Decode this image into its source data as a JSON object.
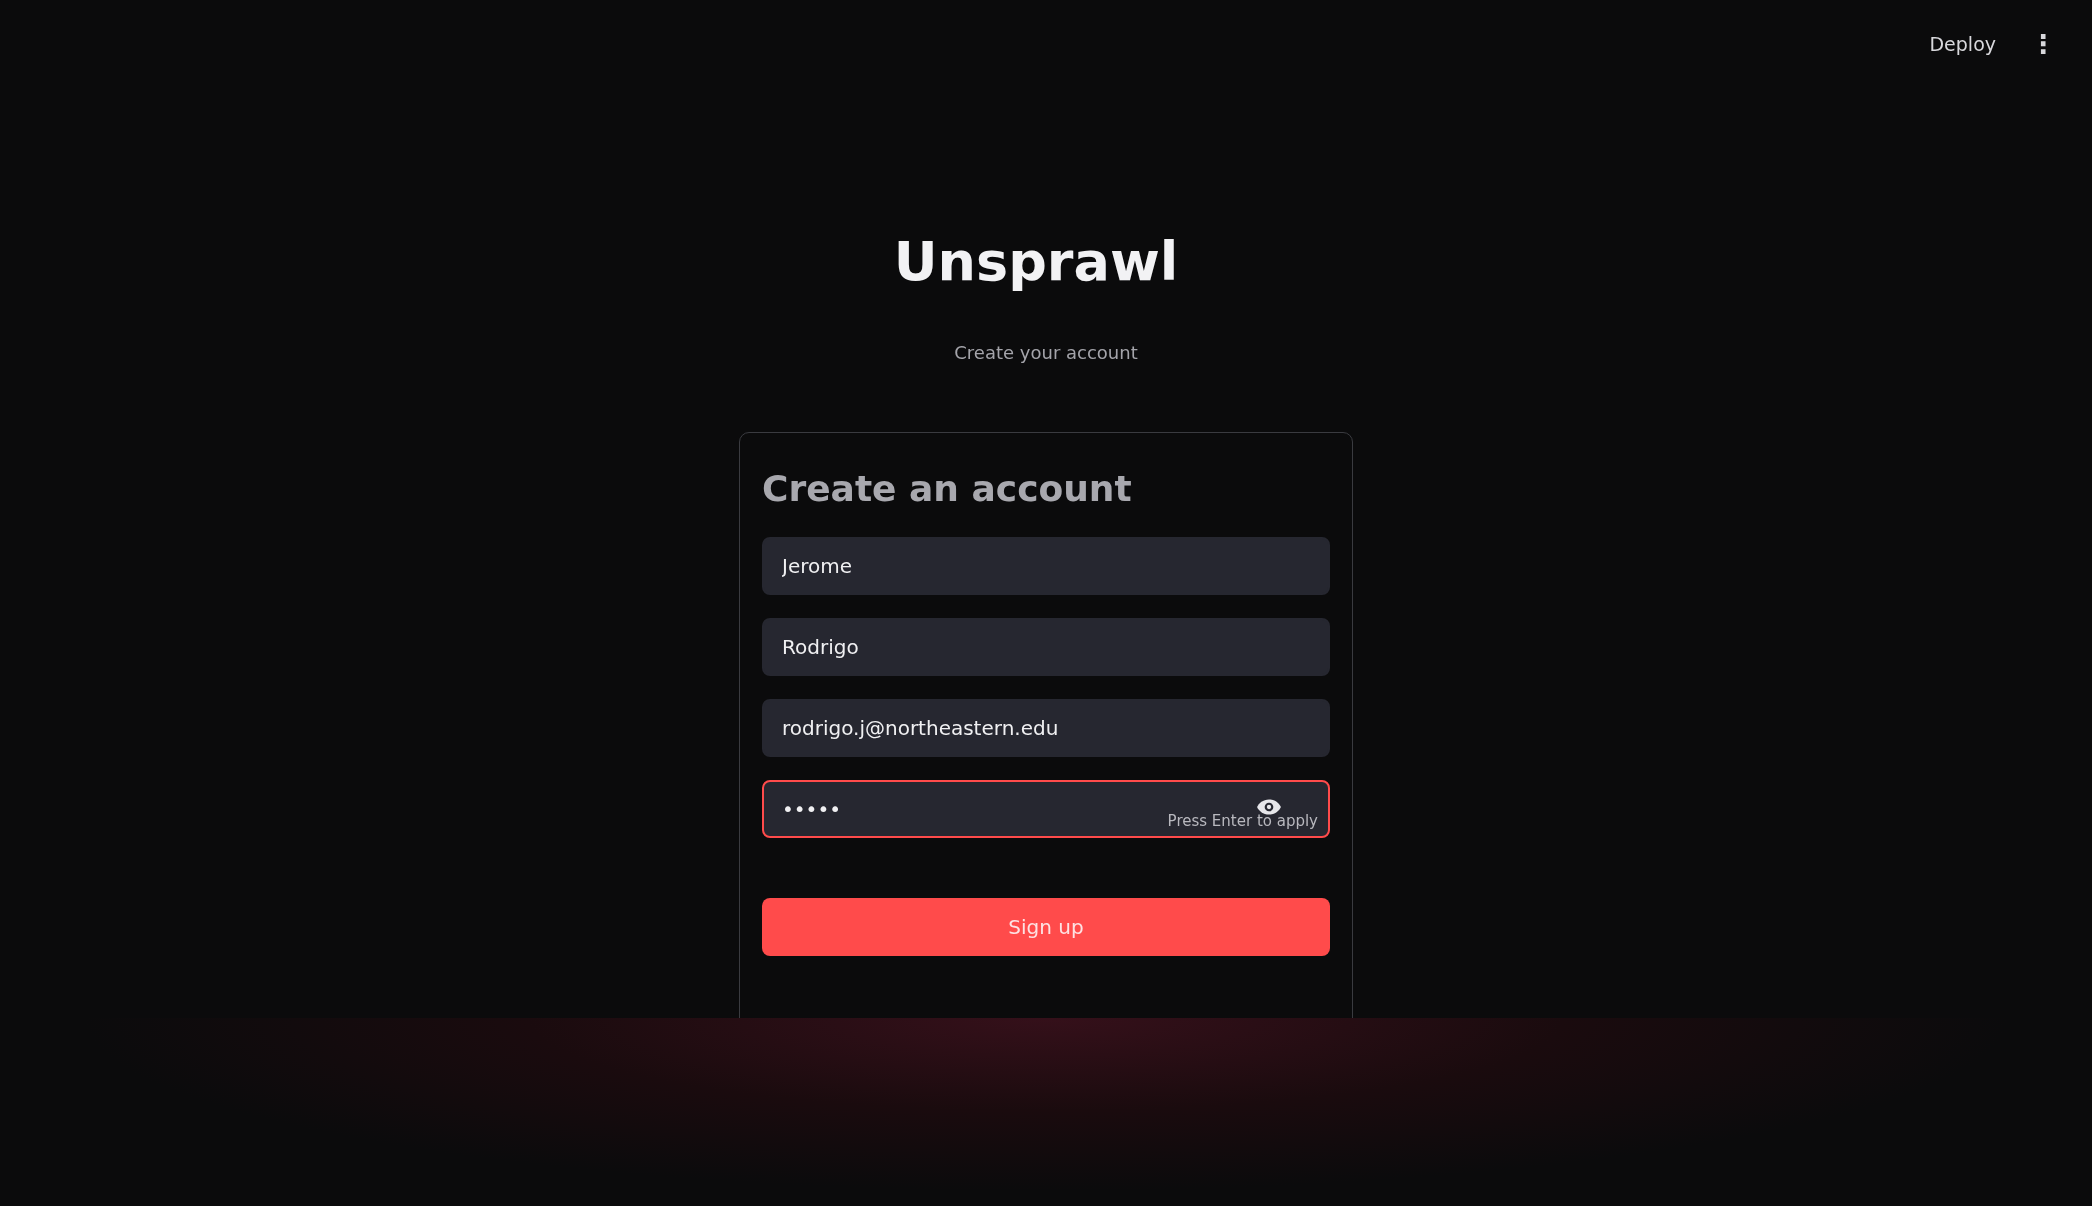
{
  "toolbar": {
    "deploy": "Deploy",
    "menu": "⋮"
  },
  "header": {
    "title": "Unsprawl",
    "subtitle": "Create your account"
  },
  "form": {
    "heading": "Create an account",
    "fields": [
      {
        "value": "Jerome",
        "focused": false
      },
      {
        "value": "Rodrigo",
        "focused": false
      },
      {
        "value": "rodrigo.j@northeastern.edu",
        "focused": false
      },
      {
        "value": "•••••",
        "focused": true,
        "hint": "Press Enter to apply",
        "kind": "password"
      }
    ],
    "submit": "Sign up"
  }
}
